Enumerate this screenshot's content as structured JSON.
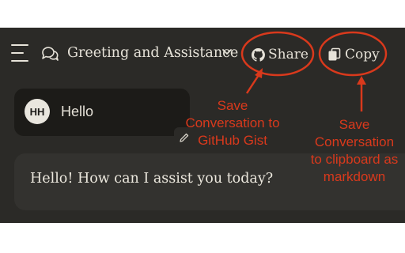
{
  "header": {
    "conversation_title": "Greeting and Assistance",
    "share_label": "Share",
    "copy_label": "Copy"
  },
  "icons": {
    "menu": "hamburger-menu-icon",
    "chat": "chat-bubbles-icon",
    "chevron": "chevron-down-icon",
    "share": "github-icon",
    "copy": "copy-icon",
    "edit": "pencil-icon"
  },
  "messages": {
    "user": {
      "avatar_initials": "HH",
      "text": "Hello"
    },
    "assistant": {
      "text": "Hello! How can I assist you today?"
    }
  },
  "annotations": {
    "share_note": "Save\nConversation to\nGitHub Gist",
    "copy_note": "Save\nConversation\nto clipboard as\nmarkdown"
  },
  "colors": {
    "panel_bg": "#2b2a27",
    "user_bubble_bg": "#1c1b18",
    "assistant_bubble_bg": "#33322f",
    "text": "#e6e2d8",
    "annotation": "#d9391c"
  }
}
